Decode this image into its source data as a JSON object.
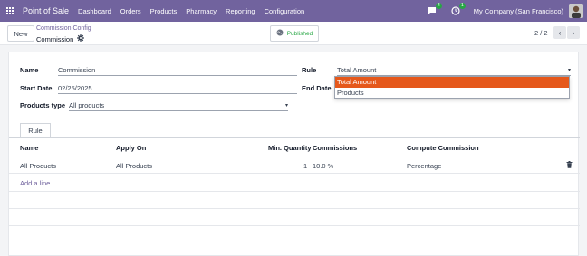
{
  "navbar": {
    "brand": "Point of Sale",
    "menu": [
      "Dashboard",
      "Orders",
      "Products",
      "Pharmacy",
      "Reporting",
      "Configuration"
    ],
    "messages_count": "4",
    "activities_count": "1",
    "company": "My Company (San Francisco)"
  },
  "control": {
    "new_label": "New",
    "breadcrumb_parent": "Commission Config",
    "breadcrumb_current": "Commission",
    "status_label": "Published",
    "pager": "2 / 2"
  },
  "form": {
    "name_label": "Name",
    "name_value": "Commission",
    "start_date_label": "Start Date",
    "start_date_value": "02/25/2025",
    "products_type_label": "Products type",
    "products_type_value": "All products",
    "rule_label": "Rule",
    "rule_value": "Total Amount",
    "end_date_label": "End Date"
  },
  "tabs": [
    "Rule"
  ],
  "table": {
    "headers": [
      "Name",
      "Apply On",
      "Min. Quantity",
      "Commissions",
      "Compute Commission"
    ],
    "rows": [
      {
        "name": "All Products",
        "apply_on": "All Products",
        "min_quantity": "1",
        "commissions": "10.0 %",
        "compute": "Percentage"
      }
    ],
    "add_line": "Add a line"
  },
  "dropdown": {
    "options": [
      "Total Amount",
      "Products"
    ],
    "selected": "Total Amount"
  },
  "colors": {
    "navbar": "#71639e",
    "accent": "#71639e",
    "highlight": "#e5581b",
    "status": "#28a745"
  }
}
